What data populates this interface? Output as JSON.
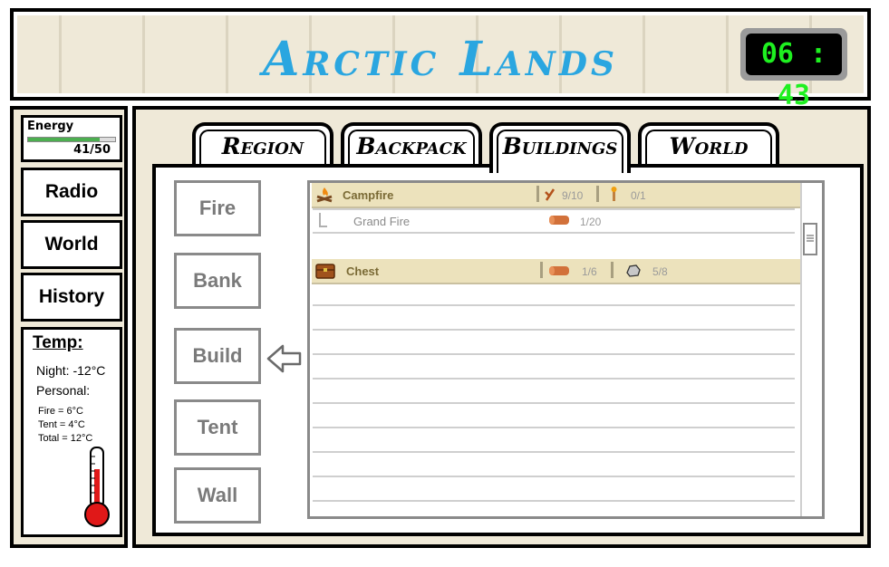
{
  "header": {
    "title": "Arctic Lands",
    "clock": "06 : 43"
  },
  "sidebar": {
    "energy_label": "Energy",
    "energy_value": "41/50",
    "energy_fraction": 0.82,
    "buttons": [
      "Radio",
      "World",
      "History"
    ],
    "temp": {
      "title": "Temp:",
      "night": "Night: -12°C",
      "personal": "Personal:",
      "fire": "Fire = 6°C",
      "tent": "Tent = 4°C",
      "total": "Total = 12°C"
    }
  },
  "tabs": [
    "Region",
    "Backpack",
    "Buildings",
    "World"
  ],
  "active_tab": "Buildings",
  "building_buttons": [
    "Fire",
    "Bank",
    "Build",
    "Tent",
    "Wall"
  ],
  "buildings_list": {
    "campfire": {
      "name": "Campfire",
      "req1": "9/10",
      "req2": "0/1",
      "sub_name": "Grand Fire",
      "sub_req": "1/20"
    },
    "chest": {
      "name": "Chest",
      "req1": "1/6",
      "req2": "5/8"
    }
  },
  "colors": {
    "title": "#2aa6e0",
    "clock": "#1ef020",
    "row_bg": "#ece2bc"
  }
}
